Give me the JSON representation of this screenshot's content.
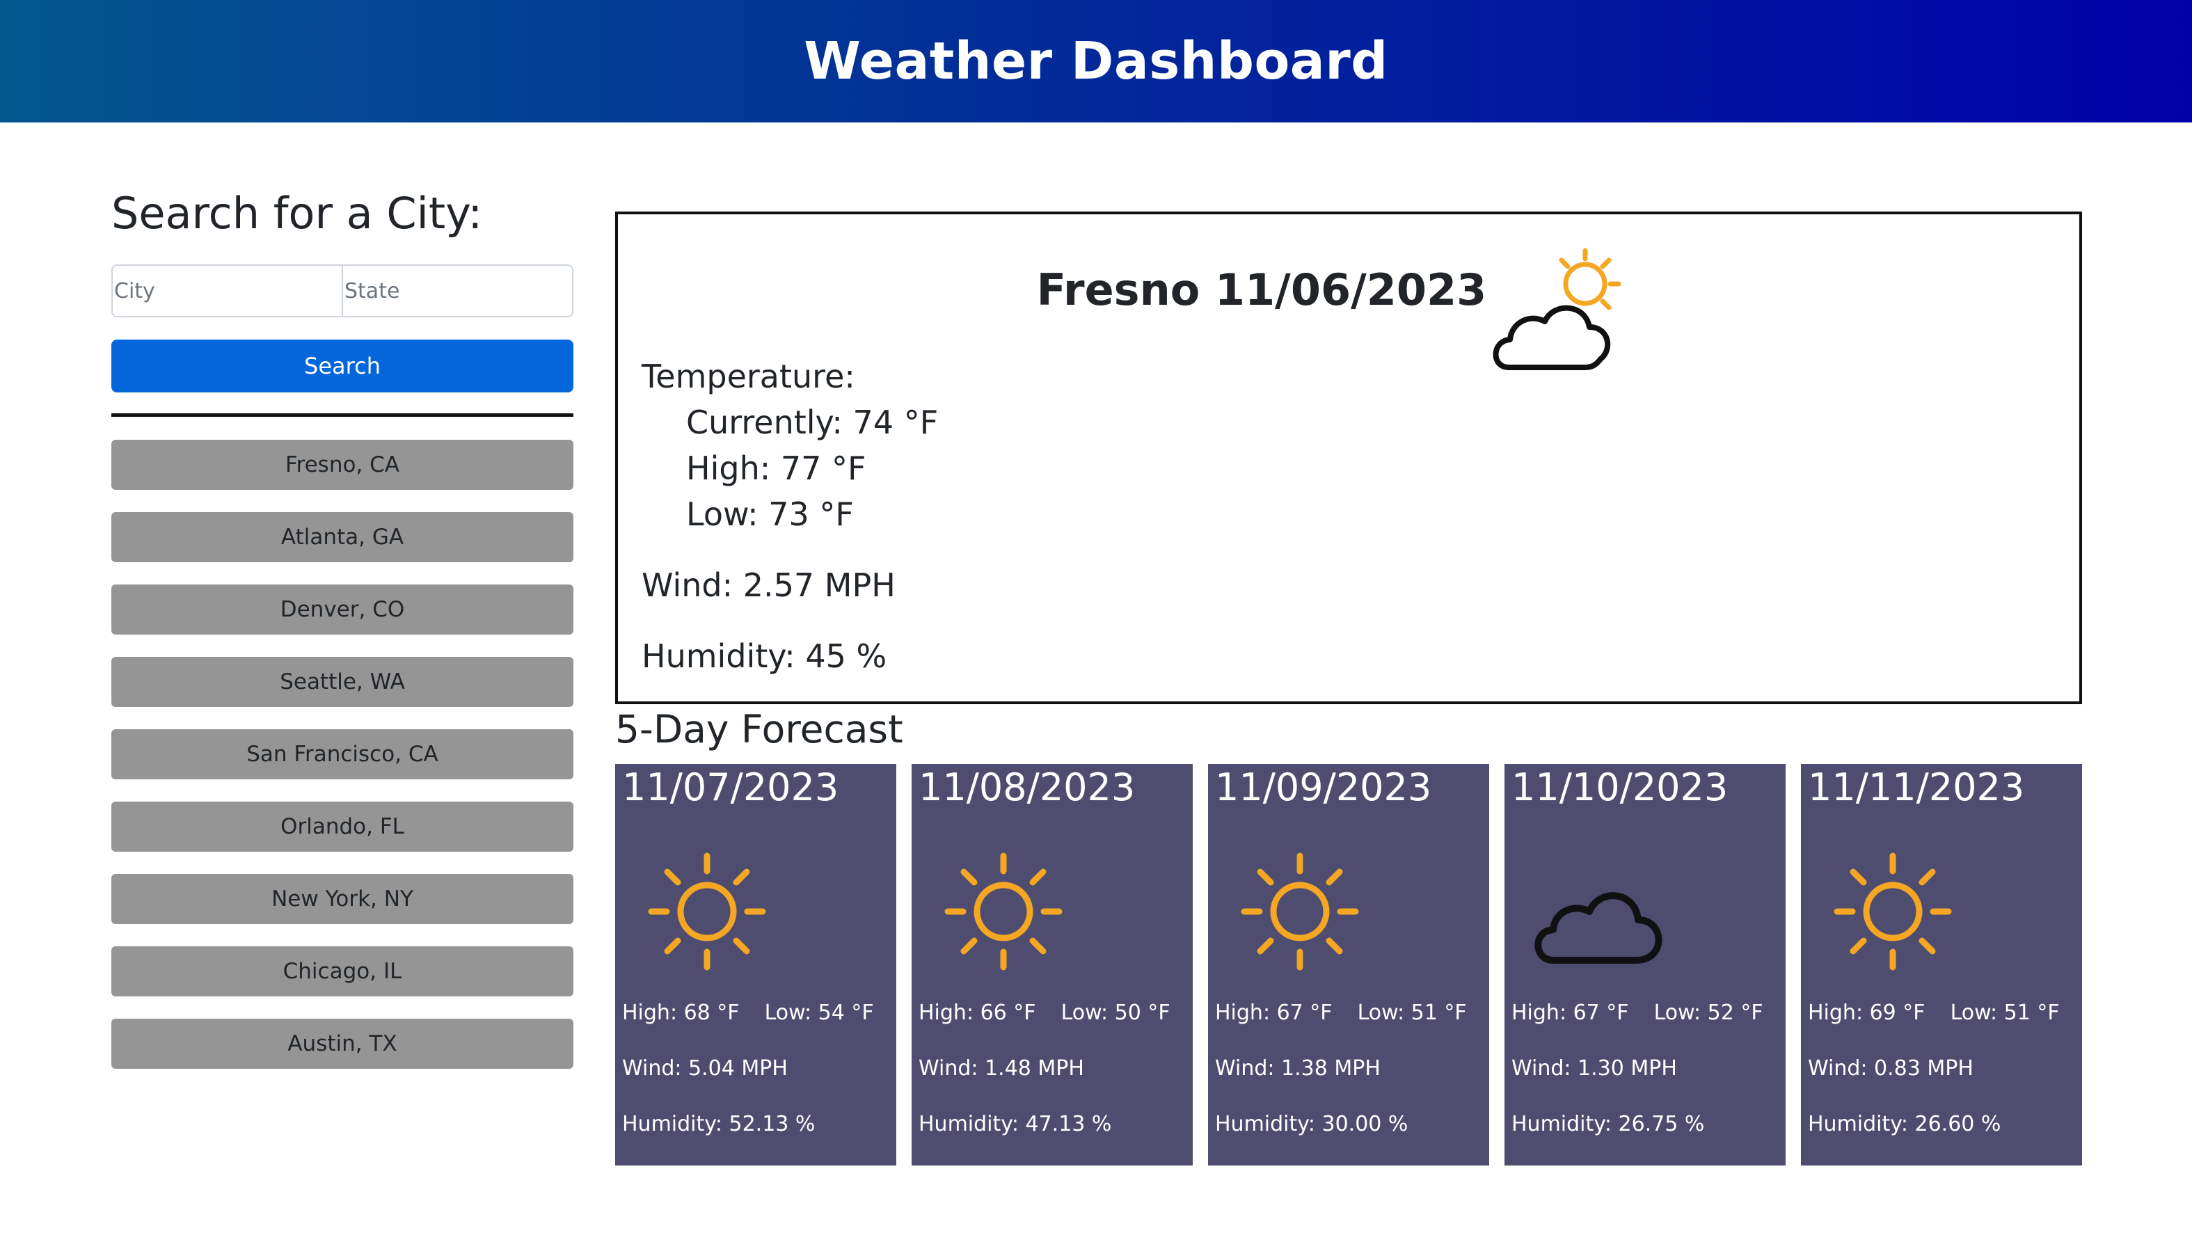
{
  "header": {
    "title": "Weather Dashboard"
  },
  "search": {
    "heading": "Search for a City:",
    "city_placeholder": "City",
    "state_placeholder": "State",
    "button_label": "Search"
  },
  "history": [
    "Fresno, CA",
    "Atlanta, GA",
    "Denver, CO",
    "Seattle, WA",
    "San Francisco, CA",
    "Orlando, FL",
    "New York, NY",
    "Chicago, IL",
    "Austin, TX"
  ],
  "current": {
    "title": "Fresno 11/06/2023",
    "icon": "partly-cloudy-icon",
    "temperature_label": "Temperature:",
    "currently": "Currently: 74 °F",
    "high": "High: 77 °F",
    "low": "Low: 73 °F",
    "wind": "Wind: 2.57 MPH",
    "humidity": "Humidity: 45 %"
  },
  "forecast": {
    "heading": "5-Day Forecast",
    "days": [
      {
        "date": "11/07/2023",
        "icon": "sun-icon",
        "high": "High: 68 °F",
        "low": "Low: 54 °F",
        "wind": "Wind: 5.04 MPH",
        "humidity": "Humidity: 52.13 %"
      },
      {
        "date": "11/08/2023",
        "icon": "sun-icon",
        "high": "High: 66 °F",
        "low": "Low: 50 °F",
        "wind": "Wind: 1.48 MPH",
        "humidity": "Humidity: 47.13 %"
      },
      {
        "date": "11/09/2023",
        "icon": "sun-icon",
        "high": "High: 67 °F",
        "low": "Low: 51 °F",
        "wind": "Wind: 1.38 MPH",
        "humidity": "Humidity: 30.00 %"
      },
      {
        "date": "11/10/2023",
        "icon": "cloud-icon",
        "high": "High: 67 °F",
        "low": "Low: 52 °F",
        "wind": "Wind: 1.30 MPH",
        "humidity": "Humidity: 26.75 %"
      },
      {
        "date": "11/11/2023",
        "icon": "sun-icon",
        "high": "High: 69 °F",
        "low": "Low: 51 °F",
        "wind": "Wind: 0.83 MPH",
        "humidity": "Humidity: 26.60 %"
      }
    ]
  },
  "colors": {
    "header_start": "#03578f",
    "header_end": "#0101a8",
    "search_button": "#0367db",
    "history_button": "#959595",
    "forecast_card": "#4e4d70",
    "sun": "#f5a623"
  }
}
